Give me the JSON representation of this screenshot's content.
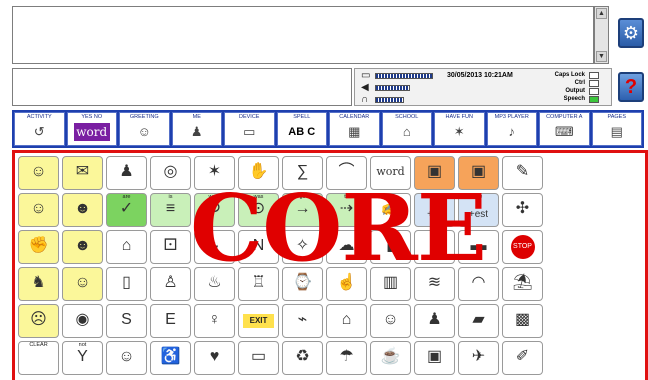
{
  "message_window": {
    "text": "",
    "predictions": ""
  },
  "status": {
    "datetime": "30/05/2013 10:21AM",
    "locks": [
      {
        "label": "Caps Lock",
        "on": false
      },
      {
        "label": "Ctrl",
        "on": false
      },
      {
        "label": "Output",
        "on": false
      },
      {
        "label": "Speech",
        "on": true
      }
    ],
    "levels": {
      "battery": 0.9,
      "volume": 0.55,
      "headphone": 0.45
    }
  },
  "side_buttons": {
    "settings_icon": "gear-icon",
    "help_label": "?"
  },
  "tabs": [
    {
      "label": "ACTIVITY",
      "icon": "↺"
    },
    {
      "label": "YES NO",
      "icon": "word"
    },
    {
      "label": "GREETING",
      "icon": "☺"
    },
    {
      "label": "ME",
      "icon": "♟"
    },
    {
      "label": "DEVICE",
      "icon": "▭"
    },
    {
      "label": "SPELL",
      "icon": "AB C"
    },
    {
      "label": "CALENDAR",
      "icon": "▦"
    },
    {
      "label": "SCHOOL",
      "icon": "⌂"
    },
    {
      "label": "HAVE FUN",
      "icon": "✶"
    },
    {
      "label": "MP3 PLAYER",
      "icon": "♪"
    },
    {
      "label": "COMPUTER A",
      "icon": "⌨"
    },
    {
      "label": "PAGES",
      "icon": "▤"
    }
  ],
  "core": {
    "watermark": "CORE",
    "rows": [
      [
        {
          "label": "",
          "icon": "☺",
          "color": "y"
        },
        {
          "label": "",
          "icon": "✉",
          "color": "y"
        },
        {
          "label": "",
          "icon": "♟",
          "color": "w"
        },
        {
          "label": "",
          "icon": "◎",
          "color": "w"
        },
        {
          "label": "",
          "icon": "✶",
          "color": "w"
        },
        {
          "label": "",
          "icon": "✋",
          "color": "w"
        },
        {
          "label": "",
          "icon": "∑",
          "color": "w"
        },
        {
          "label": "",
          "icon": "⌒",
          "color": "w"
        },
        {
          "label": "",
          "icon": "word",
          "color": "w"
        },
        {
          "label": "",
          "icon": "▣",
          "color": "o"
        },
        {
          "label": "",
          "icon": "▣",
          "color": "o"
        },
        {
          "label": "",
          "icon": "✎",
          "color": "w"
        }
      ],
      [
        {
          "label": "",
          "icon": "☺",
          "color": "y"
        },
        {
          "label": "",
          "icon": "☻",
          "color": "y"
        },
        {
          "label": "are",
          "icon": "✓",
          "color": "g"
        },
        {
          "label": "is",
          "icon": "≡",
          "color": "lg"
        },
        {
          "label": "were",
          "icon": "↻",
          "color": "lg"
        },
        {
          "label": "was",
          "icon": "⊙",
          "color": "lg"
        },
        {
          "label": "go",
          "icon": "→",
          "color": "lg"
        },
        {
          "label": "to",
          "icon": "⇢",
          "color": "lg"
        },
        {
          "label": "plus",
          "icon": "✍",
          "color": "w"
        },
        {
          "label": "an",
          "icon": "+er",
          "color": "b"
        },
        {
          "label": "the",
          "icon": "+est",
          "color": "b"
        },
        {
          "label": "",
          "icon": "✣",
          "color": "w"
        }
      ],
      [
        {
          "label": "",
          "icon": "✊",
          "color": "y"
        },
        {
          "label": "",
          "icon": "☻",
          "color": "y"
        },
        {
          "label": "",
          "icon": "⌂",
          "color": "w"
        },
        {
          "label": "",
          "icon": "⚀",
          "color": "w"
        },
        {
          "label": "",
          "icon": "◒",
          "color": "w"
        },
        {
          "label": "",
          "icon": "N",
          "color": "w"
        },
        {
          "label": "",
          "icon": "✧",
          "color": "w"
        },
        {
          "label": "",
          "icon": "☁",
          "color": "w"
        },
        {
          "label": "",
          "icon": "▮",
          "color": "w"
        },
        {
          "label": "",
          "icon": "♫",
          "color": "w"
        },
        {
          "label": "",
          "icon": "▬",
          "color": "w"
        },
        {
          "label": "",
          "icon": "STOP",
          "color": "w"
        }
      ],
      [
        {
          "label": "",
          "icon": "♞",
          "color": "y"
        },
        {
          "label": "",
          "icon": "☺",
          "color": "y"
        },
        {
          "label": "",
          "icon": "▯",
          "color": "w"
        },
        {
          "label": "",
          "icon": "♙",
          "color": "w"
        },
        {
          "label": "",
          "icon": "♨",
          "color": "w"
        },
        {
          "label": "",
          "icon": "♖",
          "color": "w"
        },
        {
          "label": "",
          "icon": "⌚",
          "color": "w"
        },
        {
          "label": "",
          "icon": "☝",
          "color": "w"
        },
        {
          "label": "",
          "icon": "▥",
          "color": "w"
        },
        {
          "label": "",
          "icon": "≋",
          "color": "w"
        },
        {
          "label": "",
          "icon": "◠",
          "color": "w"
        },
        {
          "label": "",
          "icon": "⛱",
          "color": "w"
        }
      ],
      [
        {
          "label": "",
          "icon": "☹",
          "color": "y"
        },
        {
          "label": "",
          "icon": "◉",
          "color": "w"
        },
        {
          "label": "",
          "icon": "S",
          "color": "w"
        },
        {
          "label": "",
          "icon": "E",
          "color": "w"
        },
        {
          "label": "",
          "icon": "♀",
          "color": "w"
        },
        {
          "label": "",
          "icon": "EXIT",
          "color": "w"
        },
        {
          "label": "",
          "icon": "⌁",
          "color": "w"
        },
        {
          "label": "",
          "icon": "⌂",
          "color": "w"
        },
        {
          "label": "",
          "icon": "☺",
          "color": "w"
        },
        {
          "label": "",
          "icon": "♟",
          "color": "w"
        },
        {
          "label": "",
          "icon": "▰",
          "color": "w"
        },
        {
          "label": "",
          "icon": "▩",
          "color": "w"
        }
      ],
      [
        {
          "label": "CLEAR",
          "icon": "",
          "color": "w"
        },
        {
          "label": "not",
          "icon": "Y",
          "color": "w"
        },
        {
          "label": "",
          "icon": "☺",
          "color": "w"
        },
        {
          "label": "",
          "icon": "♿",
          "color": "w"
        },
        {
          "label": "",
          "icon": "♥",
          "color": "w"
        },
        {
          "label": "",
          "icon": "▭",
          "color": "w"
        },
        {
          "label": "",
          "icon": "♻",
          "color": "w"
        },
        {
          "label": "",
          "icon": "☂",
          "color": "w"
        },
        {
          "label": "",
          "icon": "☕",
          "color": "w"
        },
        {
          "label": "",
          "icon": "▣",
          "color": "w"
        },
        {
          "label": "",
          "icon": "✈",
          "color": "w"
        },
        {
          "label": "",
          "icon": "✐",
          "color": "w"
        }
      ]
    ]
  },
  "colors": {
    "tab_bar": "#1e3fae",
    "core_border": "#e01010",
    "watermark": "#e00000"
  }
}
